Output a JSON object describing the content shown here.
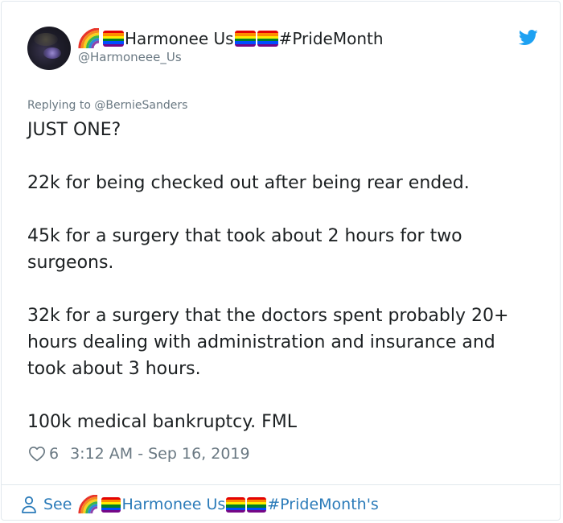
{
  "tweet": {
    "display_name": "Harmonee Us",
    "hashtag": "#PrideMonth",
    "handle": "@Harmoneee_Us",
    "replying_to": "Replying to @BernieSanders",
    "text_lines": [
      "JUST ONE?",
      "22k for being checked out after being rear ended.",
      "45k for a surgery that took about 2 hours for two surgeons.",
      "32k for a surgery that the doctors spent probably 20+ hours dealing with administration and insurance and took about 3 hours.",
      "100k medical bankruptcy. FML"
    ],
    "likes": "6",
    "timestamp": "3:12 AM - Sep 16, 2019"
  },
  "footer": {
    "see_label": "See",
    "display_name": "Harmonee Us",
    "hashtag_possessive": "#PrideMonth's"
  },
  "icons": {
    "avatar": "avatar",
    "rainbow": "rainbow-emoji-icon",
    "pride_flag": "pride-flag-icon",
    "twitter": "twitter-bird-icon",
    "heart": "heart-icon",
    "person": "person-icon"
  },
  "colors": {
    "text": "#1c2022",
    "secondary": "#697882",
    "link": "#2b7bb9",
    "twitter_blue": "#1da1f2",
    "border": "#e1e8ed",
    "flag_stripes": [
      "#e40303",
      "#ff8c00",
      "#ffed00",
      "#008026",
      "#004dff",
      "#750787"
    ]
  }
}
